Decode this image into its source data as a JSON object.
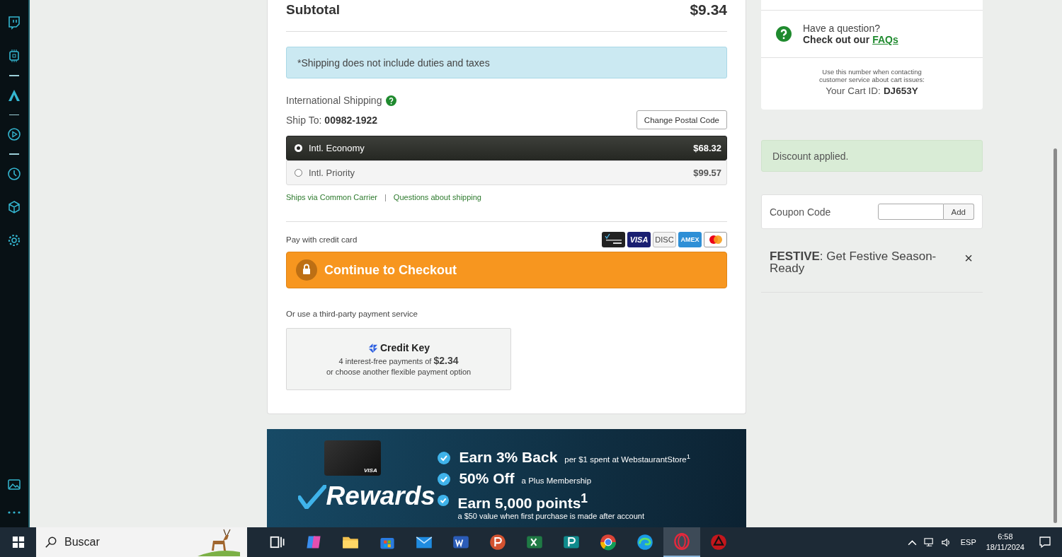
{
  "order": {
    "subtotal_label": "Subtotal",
    "subtotal": "$9.34",
    "shipping_note": "*Shipping does not include duties and taxes",
    "international_shipping_label": "International Shipping",
    "ship_to_label": "Ship To:",
    "ship_to_code": "00982-1922",
    "change_postal_button": "Change Postal Code",
    "shipping_options": [
      {
        "label": "Intl. Economy",
        "price": "$68.32",
        "selected": true
      },
      {
        "label": "Intl. Priority",
        "price": "$99.57",
        "selected": false
      }
    ],
    "links": [
      "Ships via Common Carrier",
      "Questions about shipping"
    ],
    "link_separator": "|",
    "pay_label": "Pay with credit card",
    "cards": [
      {
        "kind": "rewards"
      },
      {
        "kind": "visa",
        "label": "VISA"
      },
      {
        "kind": "discover",
        "label": "DISC"
      },
      {
        "kind": "amex",
        "label": "AMEX"
      },
      {
        "kind": "mastercard"
      }
    ],
    "checkout_button": "Continue to Checkout",
    "third_party_label": "Or use a third-party payment service",
    "credit_key": {
      "name": "Credit Key",
      "line1": "4 interest-free payments of **$2.34**",
      "line2": "or choose another flexible payment option"
    }
  },
  "banner": {
    "brand": "Rewards",
    "card_brand": "VISA",
    "benefits": [
      {
        "title": "Earn 3% Back",
        "detail": "per $1 spent at WebstaurantStore$^{1}$"
      },
      {
        "title": "50% Off",
        "detail": "a Plus Membership"
      },
      {
        "title": "Earn 5,000 points$^{1}$",
        "detail": "a $50 value when first purchase is made after account"
      }
    ]
  },
  "help": {
    "question": "Have a question?",
    "cta": "Check out our",
    "link": "FAQs"
  },
  "cart_id": {
    "note": "Use this number when contacting customer service about cart issues:",
    "label": "Your Cart ID:",
    "value": "DJ653Y"
  },
  "discount_message": "Discount applied.",
  "coupon": {
    "label": "Coupon Code",
    "button": "Add"
  },
  "promo": {
    "text": "**FESTIVE**: Get Festive Season-Ready",
    "close": "×"
  },
  "taskbar": {
    "search_placeholder": "Buscar",
    "language": "ESP",
    "time": "6:58",
    "date": "18/11/2024"
  }
}
